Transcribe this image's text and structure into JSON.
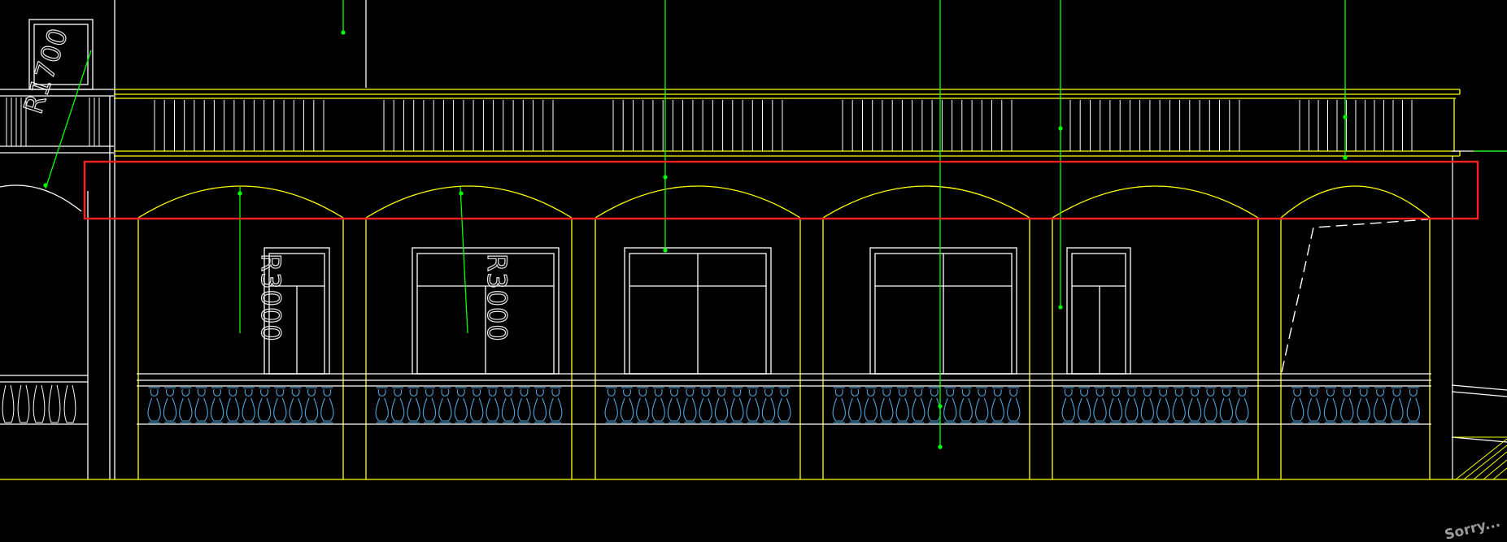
{
  "drawing": {
    "labels": {
      "r1700": "R1700",
      "r3000_a": "R3000",
      "r3000_b": "R3000"
    },
    "watermark": "Sorry..."
  },
  "colors": {
    "background": "#000000",
    "structure": "#ffff00",
    "outline": "#ffffff",
    "leader": "#00ff00",
    "baluster": "#4ea3d9",
    "highlight": "#ff2020"
  },
  "icons": {
    "baluster": "baluster-icon",
    "arch": "arch-icon"
  }
}
